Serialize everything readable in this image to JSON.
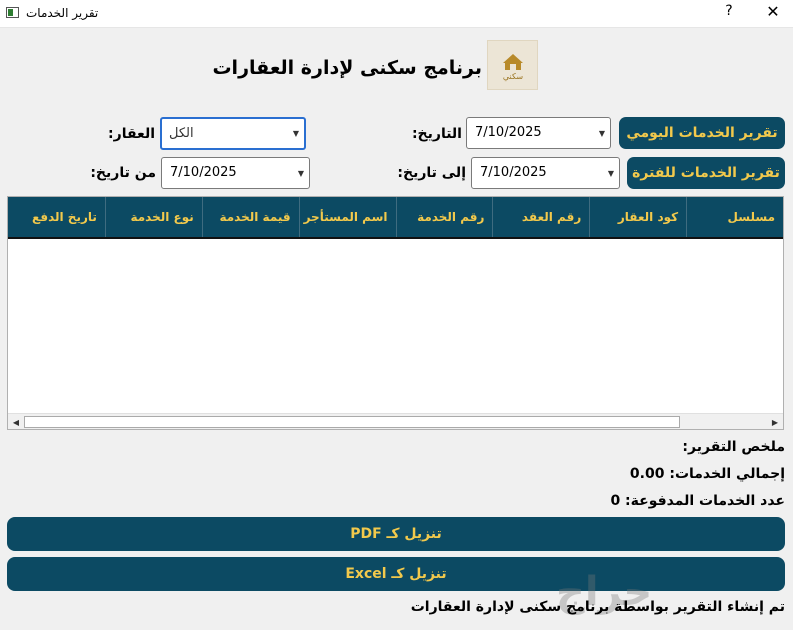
{
  "window": {
    "title": "تقرير الخدمات",
    "help_label": "?",
    "close_label": "✕"
  },
  "header": {
    "title": "برنامج سكنى لإدارة العقارات",
    "logo_text": "سكني"
  },
  "filters": {
    "daily_report_button": "تقرير الخدمات اليومي",
    "period_report_button": "تقرير الخدمات للفترة",
    "date_label": "التاريخ:",
    "date_value": "7/10/2025",
    "property_label": "العقار:",
    "property_value": "الكل",
    "to_date_label": "إلى تاريخ:",
    "to_date_value": "7/10/2025",
    "from_date_label": "من تاريخ:",
    "from_date_value": "7/10/2025"
  },
  "table": {
    "columns": [
      "مسلسل",
      "كود العقار",
      "رقم العقد",
      "رقم الخدمة",
      "اسم المستأجر",
      "قيمة الخدمة",
      "نوع الخدمة",
      "تاريخ الدفع"
    ],
    "rows": []
  },
  "summary": {
    "heading": "ملخص التقرير:",
    "total_services": "إجمالي الخدمات: 0.00",
    "paid_count": "عدد الخدمات المدفوعة: 0"
  },
  "actions": {
    "pdf_button": "تنزيل كـ PDF",
    "excel_button": "تنزيل كـ Excel"
  },
  "footer": {
    "text": "تم إنشاء التقرير بواسطة برنامج سكنى لإدارة العقارات",
    "watermark": "حراج"
  },
  "colors": {
    "accent": "#0c4a63",
    "accent_text": "#f2c94c",
    "focus": "#2a6fd1"
  }
}
